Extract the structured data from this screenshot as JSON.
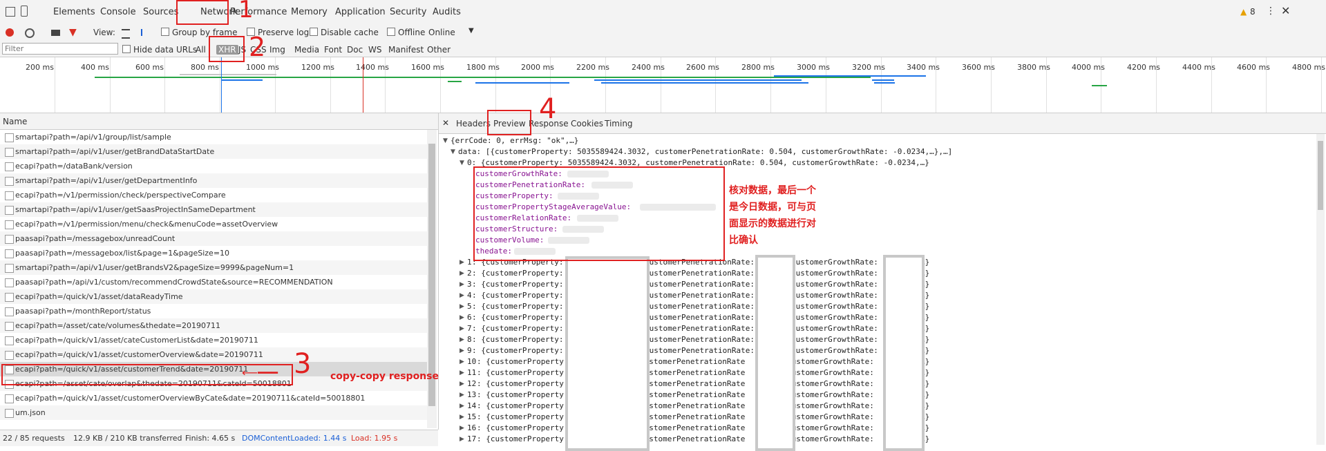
{
  "tabs": [
    "Elements",
    "Console",
    "Sources",
    "Network",
    "Performance",
    "Memory",
    "Application",
    "Security",
    "Audits"
  ],
  "warnings_count": "8",
  "toolbar": {
    "view_label": "View:",
    "group_by_frame": "Group by frame",
    "preserve_log": "Preserve log",
    "disable_cache": "Disable cache",
    "offline": "Offline",
    "throttle": "Online"
  },
  "filter": {
    "placeholder": "Filter",
    "hide_data_urls": "Hide data URLs",
    "types": [
      "All",
      "XHR",
      "JS",
      "CSS",
      "Img",
      "Media",
      "Font",
      "Doc",
      "WS",
      "Manifest",
      "Other"
    ]
  },
  "timeline_ticks": [
    "200 ms",
    "400 ms",
    "600 ms",
    "800 ms",
    "1000 ms",
    "1200 ms",
    "1400 ms",
    "1600 ms",
    "1800 ms",
    "2000 ms",
    "2200 ms",
    "2400 ms",
    "2600 ms",
    "2800 ms",
    "3000 ms",
    "3200 ms",
    "3400 ms",
    "3600 ms",
    "3800 ms",
    "4000 ms",
    "4200 ms",
    "4400 ms",
    "4600 ms",
    "4800 ms"
  ],
  "list": {
    "header": "Name",
    "rows": [
      "smartapi?path=/api/v1/group/list/sample",
      "smartapi?path=/api/v1/user/getBrandDataStartDate",
      "ecapi?path=/dataBank/version",
      "smartapi?path=/api/v1/user/getDepartmentInfo",
      "ecapi?path=/v1/permission/check/perspectiveCompare",
      "smartapi?path=/api/v1/user/getSaasProjectInSameDepartment",
      "ecapi?path=/v1/permission/menu/check&menuCode=assetOverview",
      "paasapi?path=/messagebox/unreadCount",
      "paasapi?path=/messagebox/list&page=1&pageSize=10",
      "smartapi?path=/api/v1/user/getBrandsV2&pageSize=9999&pageNum=1",
      "paasapi?path=/api/v1/custom/recommendCrowdState&source=RECOMMENDATION",
      "ecapi?path=/quick/v1/asset/dataReadyTime",
      "paasapi?path=/monthReport/status",
      "ecapi?path=/asset/cate/volumes&thedate=20190711",
      "ecapi?path=/quick/v1/asset/cateCustomerList&date=20190711",
      "ecapi?path=/quick/v1/asset/customerOverview&date=20190711",
      "ecapi?path=/quick/v1/asset/customerTrend&date=20190711",
      "ecapi?path=/asset/cate/overlap&thedate=20190711&cateId=50018801",
      "ecapi?path=/quick/v1/asset/customerOverviewByCate&date=20190711&cateId=50018801",
      "um.json"
    ]
  },
  "status": {
    "requests": "22 / 85 requests",
    "transferred": "12.9 KB / 210 KB transferred",
    "finish": "Finish: 4.65 s",
    "dom": "DOMContentLoaded: 1.44 s",
    "load": "Load: 1.95 s"
  },
  "detail_tabs": [
    "Headers",
    "Preview",
    "Response",
    "Cookies",
    "Timing"
  ],
  "preview": {
    "root": "{errCode: 0, errMsg: \"ok\",…}",
    "data_line": "data: [{customerProperty: 5035589424.3032, customerPenetrationRate: 0.504, customerGrowthRate: -0.0234,…},…]",
    "item0": "0: {customerProperty: 5035589424.3032, customerPenetrationRate: 0.504, customerGrowthRate: -0.0234,…}",
    "fields": [
      "customerGrowthRate:",
      "customerPenetrationRate:",
      "customerProperty:",
      "customerPropertyStageAverageValue:",
      "customerRelationRate:",
      "customerStructure:",
      "customerVolume:",
      "thedate:"
    ],
    "item_prefix_a": ": {customerProperty:",
    "item_prefix_b": ": {customerProperty",
    "pen_a": "customerPenetrationRate:",
    "pen_b": "customerPenetrationRate",
    "growth_a": "customerGrowthRate:",
    "growth_b": "customerGrowthRate:",
    "tail": "…}",
    "indices": [
      "1",
      "2",
      "3",
      "4",
      "5",
      "6",
      "7",
      "8",
      "9",
      "10",
      "11",
      "12",
      "13",
      "14",
      "15",
      "16",
      "17"
    ]
  },
  "annotations": {
    "n1": "1",
    "n2": "2",
    "n3": "3",
    "n4": "4",
    "copy_note": "copy-copy response",
    "verify_note": [
      "核对数据，最后一个",
      "是今日数据，可与页",
      "面显示的数据进行对",
      "比确认"
    ]
  },
  "colors": {
    "accent_red": "#e02020",
    "link_blue": "#1a5fd6",
    "load_red": "#d93025",
    "record_red": "#d93025"
  }
}
